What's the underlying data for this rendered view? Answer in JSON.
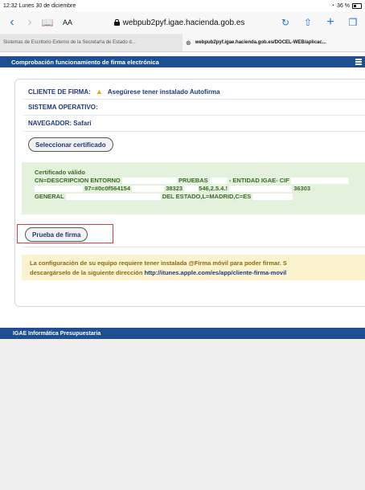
{
  "status_bar": {
    "time_date": "12:32  Lunes 30 de diciembre",
    "battery": "36 %"
  },
  "toolbar": {
    "text_size_label": "AA",
    "url": "webpub2pyf.igae.hacienda.gob.es"
  },
  "tabs": [
    {
      "label": "Sistemas de Escritorio Externo de la Secretaría de Estado d..."
    },
    {
      "label": "webpub2pyf.igae.hacienda.gob.es/DOCEL-WEB/aplicac..."
    }
  ],
  "app_header": {
    "title": "Comprobación funcionamiento de firma electrónica"
  },
  "client": {
    "label": "CLIENTE DE FIRMA:",
    "message": "Asegúrese tener instalado Autofirma"
  },
  "os": {
    "label": "SISTEMA OPERATIVO:"
  },
  "browser": {
    "label": "NAVEGADOR: Safari"
  },
  "buttons": {
    "select_cert": "Seleccionar certificado",
    "test_sign": "Prueba de firma"
  },
  "certificate": {
    "status": "Certificado válido",
    "line1": {
      "a": "CN=DESCRIPCION ENTORNO",
      "b": "PRUEBAS",
      "c": "- ENTIDAD IGAE- CIF"
    },
    "line2": {
      "a": "97=#0c0f564154",
      "b": "38323",
      "c": "546,2.5.4.!",
      "d": "36303"
    },
    "line3": {
      "a": "GENERAL",
      "b": "DEL ESTADO,L=MADRID,C=ES"
    }
  },
  "info": {
    "line1": "La configuración de su equipo requiere tener instalada @Firma móvil para poder firmar. S",
    "line2_prefix": "descargárselo de la siguiente dirección ",
    "link": "http://itunes.apple.com/es/app/cliente-firma-movil"
  },
  "footer": {
    "text": "IGAE Informática Presupuestaria"
  },
  "colors": {
    "header": "#1d4f91",
    "success_bg": "#e4f1dc",
    "warning_bg": "#fbf3d0",
    "highlight": "#e03c3c"
  }
}
